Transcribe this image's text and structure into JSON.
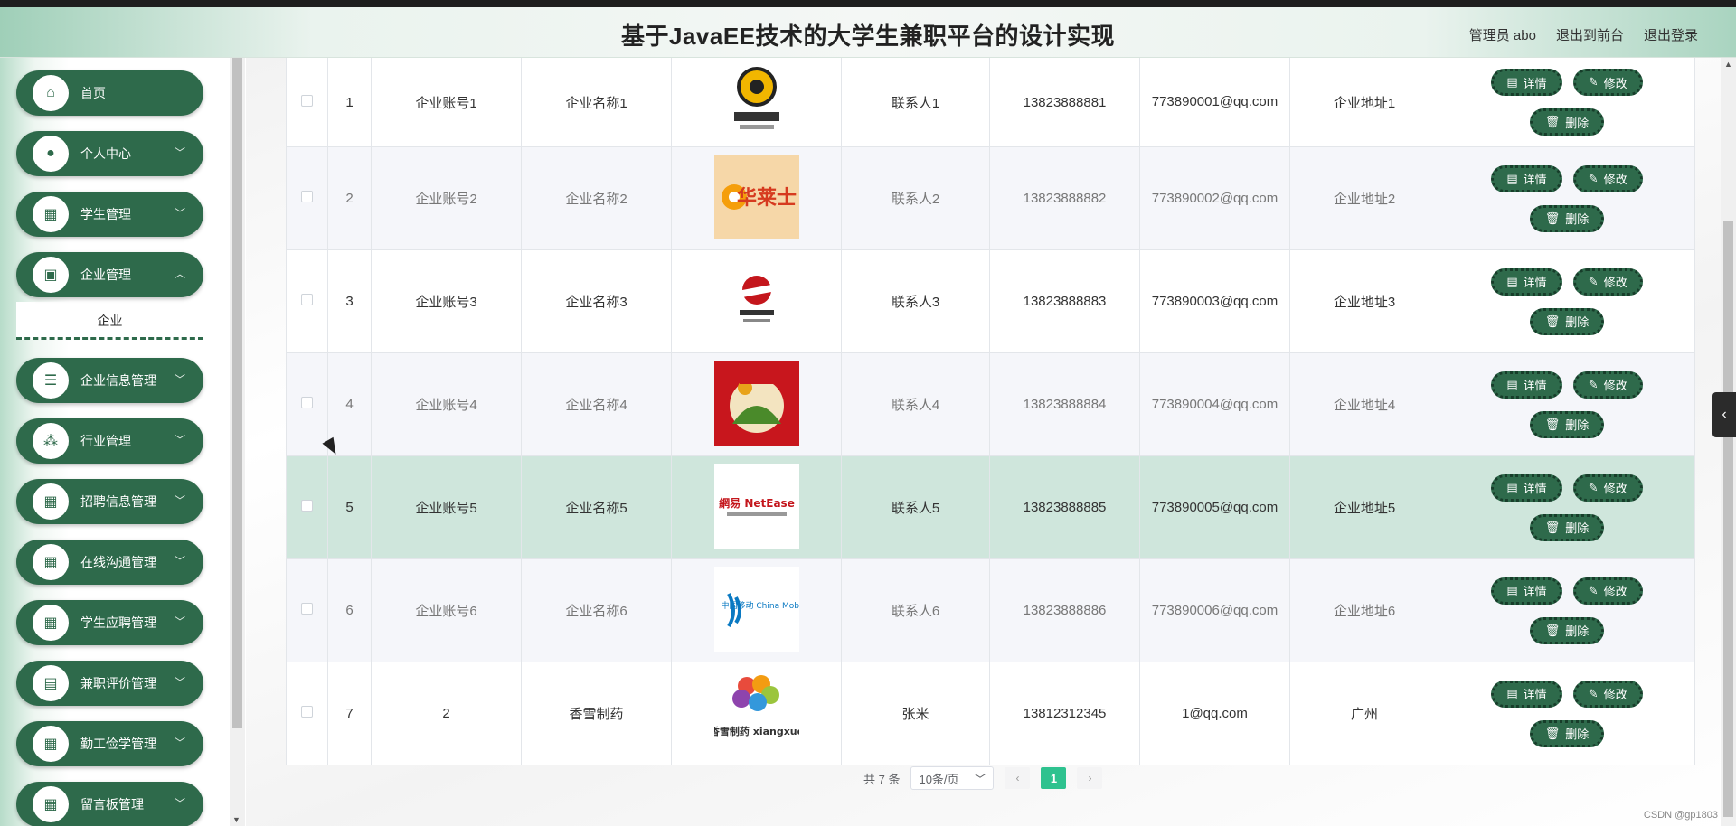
{
  "header": {
    "title": "基于JavaEE技术的大学生兼职平台的设计实现",
    "admin": "管理员 abo",
    "to_front": "退出到前台",
    "logout": "退出登录"
  },
  "sidebar": {
    "items": [
      {
        "label": "首页",
        "icon": "home-icon"
      },
      {
        "label": "个人中心",
        "icon": "user-icon"
      },
      {
        "label": "学生管理",
        "icon": "grid-icon"
      },
      {
        "label": "企业管理",
        "icon": "briefcase-icon"
      },
      {
        "label": "企业信息管理",
        "icon": "list-icon"
      },
      {
        "label": "行业管理",
        "icon": "apps-icon"
      },
      {
        "label": "招聘信息管理",
        "icon": "grid-icon"
      },
      {
        "label": "在线沟通管理",
        "icon": "grid-icon"
      },
      {
        "label": "学生应聘管理",
        "icon": "grid-icon"
      },
      {
        "label": "兼职评价管理",
        "icon": "clipboard-icon"
      },
      {
        "label": "勤工俭学管理",
        "icon": "grid-icon"
      },
      {
        "label": "留言板管理",
        "icon": "grid-icon"
      }
    ],
    "active_sub": "企业"
  },
  "table": {
    "rows": [
      {
        "idx": "1",
        "account": "企业账号1",
        "name": "企业名称1",
        "contact": "联系人1",
        "phone": "13823888881",
        "email": "773890001@qq.com",
        "address": "企业地址1"
      },
      {
        "idx": "2",
        "account": "企业账号2",
        "name": "企业名称2",
        "contact": "联系人2",
        "phone": "13823888882",
        "email": "773890002@qq.com",
        "address": "企业地址2",
        "logo_text": "华莱士"
      },
      {
        "idx": "3",
        "account": "企业账号3",
        "name": "企业名称3",
        "contact": "联系人3",
        "phone": "13823888883",
        "email": "773890003@qq.com",
        "address": "企业地址3"
      },
      {
        "idx": "4",
        "account": "企业账号4",
        "name": "企业名称4",
        "contact": "联系人4",
        "phone": "13823888884",
        "email": "773890004@qq.com",
        "address": "企业地址4"
      },
      {
        "idx": "5",
        "account": "企业账号5",
        "name": "企业名称5",
        "contact": "联系人5",
        "phone": "13823888885",
        "email": "773890005@qq.com",
        "address": "企业地址5",
        "logo_text": "網易 NetEase"
      },
      {
        "idx": "6",
        "account": "企业账号6",
        "name": "企业名称6",
        "contact": "联系人6",
        "phone": "13823888886",
        "email": "773890006@qq.com",
        "address": "企业地址6",
        "logo_text": "中国移动 China Mobile"
      },
      {
        "idx": "7",
        "account": "2",
        "name": "香雪制药",
        "contact": "张米",
        "phone": "13812312345",
        "email": "1@qq.com",
        "address": "广州",
        "logo_text": "香雪制药 xiangxue"
      }
    ],
    "btn_detail": "详情",
    "btn_edit": "修改",
    "btn_delete": "删除"
  },
  "pagination": {
    "total": "共 7 条",
    "page_size": "10条/页",
    "current": "1"
  },
  "watermark": "CSDN @gp1803",
  "colors": {
    "primary": "#2e6a4b",
    "highlight_row": "#cfe6dc",
    "page_active": "#2ec28f"
  }
}
